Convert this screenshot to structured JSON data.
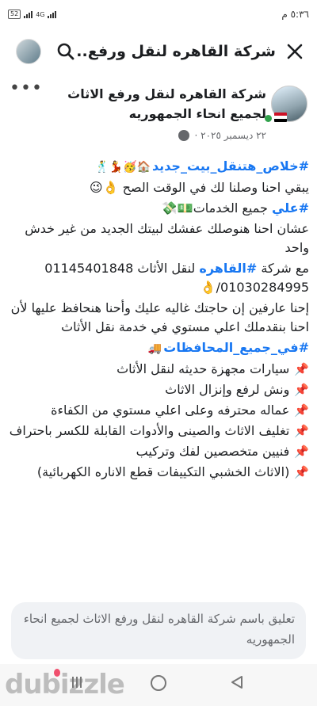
{
  "status_bar": {
    "time": "٥:٣٦ م",
    "battery": "52",
    "network": "4G"
  },
  "app_bar": {
    "title": "شركة القاهره لنقل ورفع..."
  },
  "post": {
    "page_name": "شركة القاهره لنقل ورفع الاثاث لجميع انحاء الجمهوريه",
    "date": "٢٢ ديسمبر ٢٠٢٥ ·",
    "lines": [
      {
        "hashtag": "#خلاص_هتنقل_بيت_جديد",
        "text": "🏠🥳💃🕺"
      },
      {
        "hashtag": "",
        "text": "يبقي احنا وصلنا لك في الوقت الصح 👌😉"
      },
      {
        "hashtag": "#علي",
        "text": " جميع الخدمات💵💸"
      },
      {
        "hashtag": "",
        "text": "عشان احنا هنوصلك عفشك لبيتك الجديد من غير خدش واحد"
      },
      {
        "hashtag": "",
        "text": "مع شركة ",
        "hashtag2": "#القاهره",
        "text2": " لنقل الأثاث 01145401848 01030284995/👌"
      },
      {
        "hashtag": "",
        "text": "إحنا عارفين إن حاجتك غاليه عليك وأحنا هنحافظ عليها لأن احنا بنقدملك اعلي مستوي في خدمة نقل الأثاث"
      },
      {
        "hashtag": "#في_جميع_المحافظات",
        "text": "🚚"
      }
    ],
    "bullets": [
      "سيارات مجهزة حديثه لنقل الأثاث",
      "ونش لرفع وإنزال الاثاث",
      "عماله محترفه وعلى اعلي مستوي من الكفاءة",
      "تغليف الاثاث والصينى والأدوات القابلة للكسر باحتراف",
      "فنيين متخصصين لفك وتركيب",
      "(الاثاث الخشبي التكييفات قطع الاناره الكهربائية)"
    ]
  },
  "comment": {
    "placeholder": "تعليق باسم شركة القاهره لنقل ورفع الاثاث لجميع انحاء الجمهوريه"
  },
  "footer": {
    "brand": "dubizzle"
  },
  "icons": {
    "close": "close-icon",
    "search": "search-icon",
    "more": "more-icon",
    "globe": "globe-icon",
    "pin": "pin-icon"
  }
}
